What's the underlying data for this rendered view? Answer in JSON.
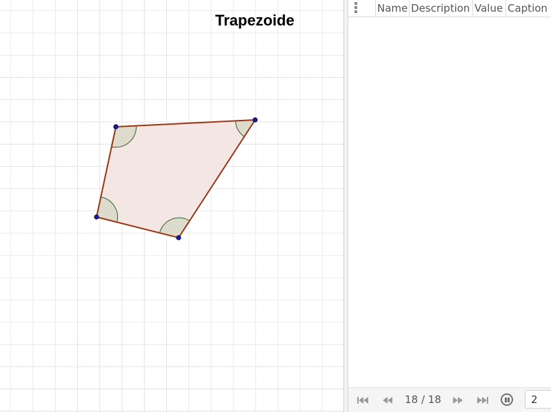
{
  "graphics": {
    "title": "Trapezoide",
    "colors": {
      "fill": "#f4e6e2",
      "edge": "#9a3411",
      "angle_fill": "#d7d8c8",
      "angle_stroke": "#2e5e2e",
      "point": "#1a1aa6",
      "grid": "#d6d6d6"
    }
  },
  "algebra": {
    "columns": {
      "name": "Name",
      "description": "Description",
      "value": "Value",
      "caption": "Caption"
    }
  },
  "playbar": {
    "counter": "18 / 18",
    "speed": "2",
    "icons": [
      "skip-start-icon",
      "step-back-icon",
      "step-forward-icon",
      "skip-end-icon",
      "pause-icon"
    ]
  }
}
